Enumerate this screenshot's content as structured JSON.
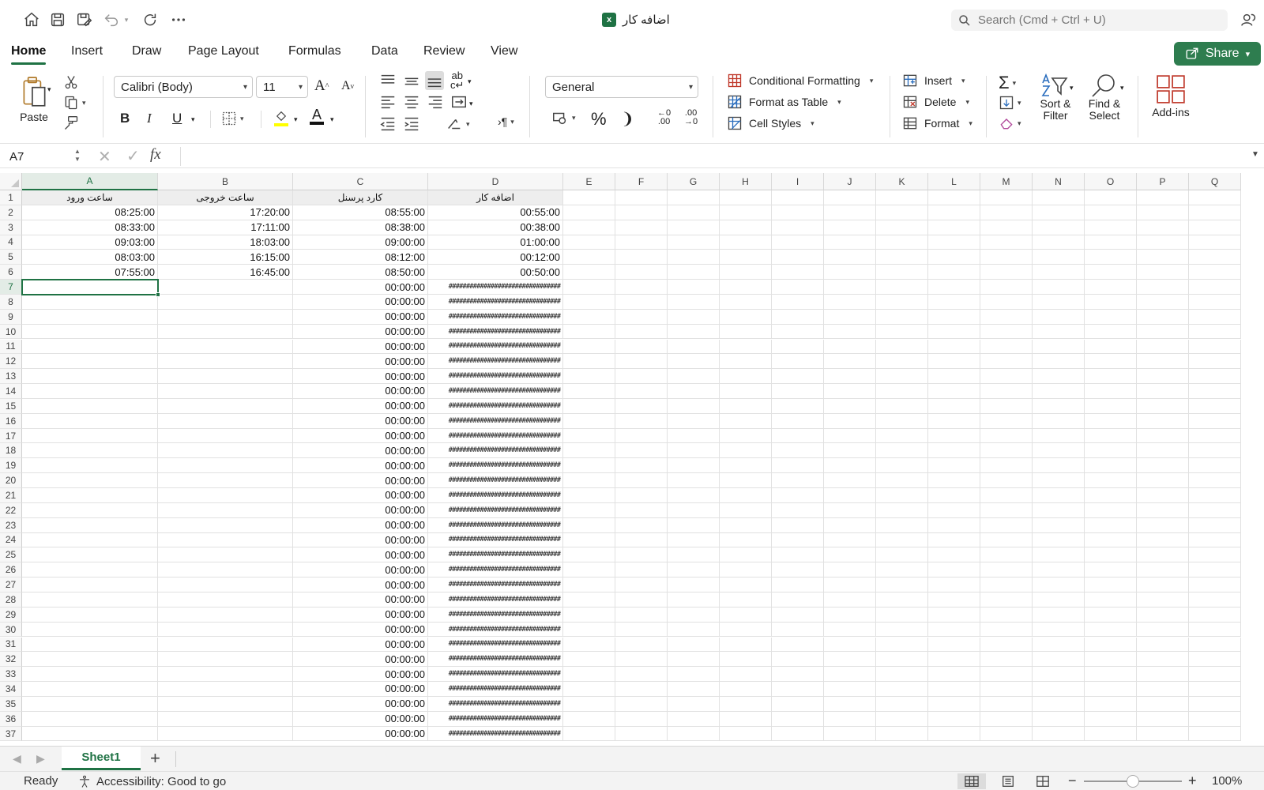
{
  "window": {
    "title": "اضافه کار",
    "search_placeholder": "Search (Cmd + Ctrl + U)",
    "share_label": "Share"
  },
  "tabs": [
    "Home",
    "Insert",
    "Draw",
    "Page Layout",
    "Formulas",
    "Data",
    "Review",
    "View"
  ],
  "active_tab": "Home",
  "ribbon": {
    "paste_label": "Paste",
    "font_name": "Calibri (Body)",
    "font_size": "11",
    "number_format": "General",
    "conditional_formatting": "Conditional Formatting",
    "format_as_table": "Format as Table",
    "cell_styles": "Cell Styles",
    "insert": "Insert",
    "delete": "Delete",
    "format": "Format",
    "sort_filter_1": "Sort &",
    "sort_filter_2": "Filter",
    "find_select_1": "Find &",
    "find_select_2": "Select",
    "add_ins": "Add-ins",
    "bold": "B",
    "italic": "I",
    "underline": "U",
    "font_color_glyph": "A",
    "percent": "%",
    "comma": "❩"
  },
  "formula_bar": {
    "name_box": "A7",
    "fx": "fx",
    "formula": ""
  },
  "columns": [
    "A",
    "B",
    "C",
    "D",
    "E",
    "F",
    "G",
    "H",
    "I",
    "J",
    "K",
    "L",
    "M",
    "N",
    "O",
    "P",
    "Q"
  ],
  "rows": {
    "first": 1,
    "last": 37,
    "header_cells": [
      "ساعت ورود",
      "ساعت خروجی",
      "کارد پرسنل",
      "اضافه کار"
    ],
    "data": [
      [
        "08:25:00",
        "17:20:00",
        "08:55:00",
        "00:55:00"
      ],
      [
        "08:33:00",
        "17:11:00",
        "08:38:00",
        "00:38:00"
      ],
      [
        "09:03:00",
        "18:03:00",
        "09:00:00",
        "01:00:00"
      ],
      [
        "08:03:00",
        "16:15:00",
        "08:12:00",
        "00:12:00"
      ],
      [
        "07:55:00",
        "16:45:00",
        "08:50:00",
        "00:50:00"
      ]
    ],
    "empty_c_value": "00:00:00",
    "empty_d_value": "################################"
  },
  "selection": {
    "col": "A",
    "row": 7
  },
  "sheets": [
    "Sheet1"
  ],
  "add_sheet": "+",
  "status": {
    "ready": "Ready",
    "accessibility": "Accessibility: Good to go",
    "zoom": "100%",
    "zoom_minus": "−",
    "zoom_plus": "+"
  },
  "colors": {
    "accent": "#1f7244",
    "share_bg": "#2e7d4f",
    "header_fill": "#eeeeee"
  }
}
